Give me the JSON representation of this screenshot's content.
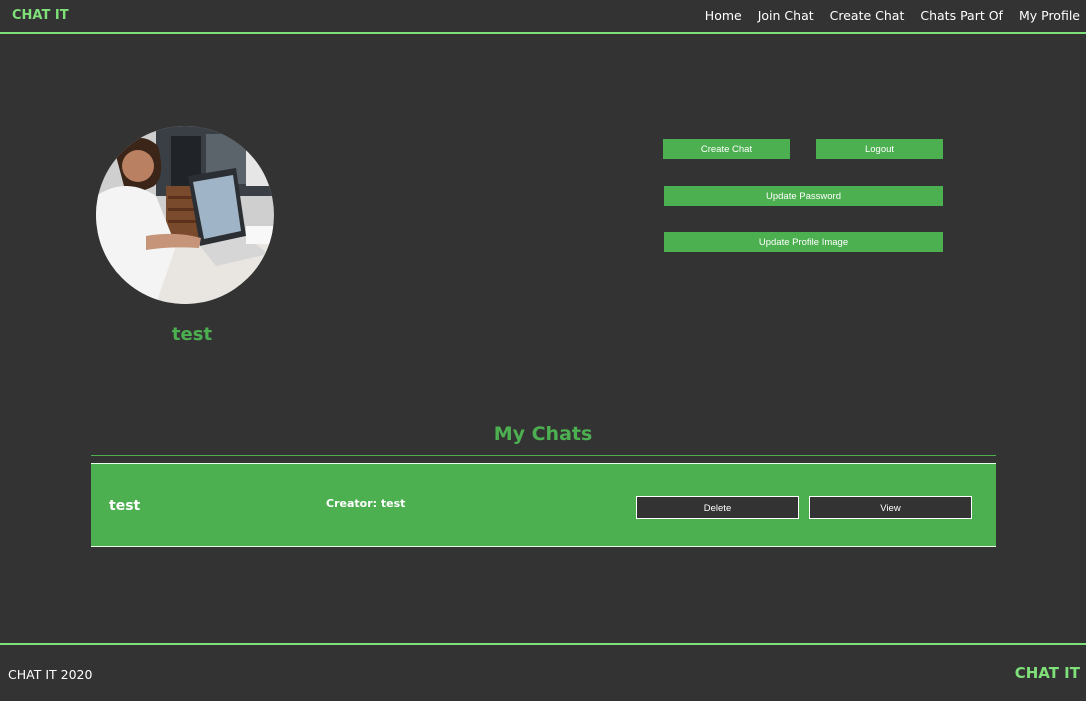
{
  "nav": {
    "brand": "CHAT IT",
    "links": [
      "Home",
      "Join Chat",
      "Create Chat",
      "Chats Part Of",
      "My Profile"
    ]
  },
  "profile": {
    "username": "test",
    "buttons": {
      "create_chat": "Create Chat",
      "logout": "Logout",
      "update_password": "Update Password",
      "update_profile_image": "Update Profile Image"
    }
  },
  "my_chats": {
    "title": "My Chats",
    "chats": [
      {
        "name": "test",
        "creator": "Creator: test",
        "delete_label": "Delete",
        "view_label": "View"
      }
    ]
  },
  "footer": {
    "copyright": "CHAT IT 2020",
    "brand": "CHAT IT"
  },
  "colors": {
    "background": "#333333",
    "accent": "#4caf50",
    "brand_green": "#7fe07a"
  }
}
